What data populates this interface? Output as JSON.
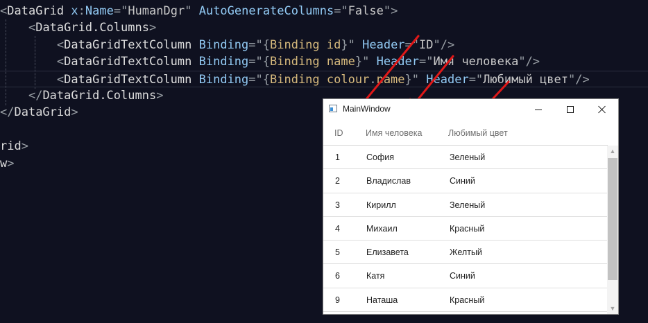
{
  "editor": {
    "lines": [
      {
        "indent": "",
        "segments": [
          {
            "t": "<",
            "c": "punct"
          },
          {
            "t": "DataGrid",
            "c": "tag"
          },
          {
            "t": " ",
            "c": "punct"
          },
          {
            "t": "x",
            "c": "ns"
          },
          {
            "t": ":",
            "c": "punct"
          },
          {
            "t": "Name",
            "c": "attr"
          },
          {
            "t": "=\"",
            "c": "punct"
          },
          {
            "t": "HumanDgr",
            "c": "str"
          },
          {
            "t": "\"",
            "c": "punct"
          },
          {
            "t": " ",
            "c": "punct"
          },
          {
            "t": "AutoGenerateColumns",
            "c": "attr"
          },
          {
            "t": "=\"",
            "c": "punct"
          },
          {
            "t": "False",
            "c": "str"
          },
          {
            "t": "\">",
            "c": "punct"
          }
        ]
      },
      {
        "indent": "    ",
        "segments": [
          {
            "t": "<",
            "c": "punct"
          },
          {
            "t": "DataGrid.Columns",
            "c": "tag"
          },
          {
            "t": ">",
            "c": "punct"
          }
        ]
      },
      {
        "indent": "        ",
        "segments": [
          {
            "t": "<",
            "c": "punct"
          },
          {
            "t": "DataGridTextColumn",
            "c": "tag"
          },
          {
            "t": " ",
            "c": "punct"
          },
          {
            "t": "Binding",
            "c": "attr"
          },
          {
            "t": "=\"{",
            "c": "punct"
          },
          {
            "t": "Binding",
            "c": "bind"
          },
          {
            "t": " ",
            "c": "punct"
          },
          {
            "t": "id",
            "c": "bind"
          },
          {
            "t": "}\"",
            "c": "punct"
          },
          {
            "t": " ",
            "c": "punct"
          },
          {
            "t": "Header",
            "c": "attr"
          },
          {
            "t": "=\"",
            "c": "punct"
          },
          {
            "t": "ID",
            "c": "str"
          },
          {
            "t": "\"/>",
            "c": "punct"
          }
        ]
      },
      {
        "indent": "        ",
        "segments": [
          {
            "t": "<",
            "c": "punct"
          },
          {
            "t": "DataGridTextColumn",
            "c": "tag"
          },
          {
            "t": " ",
            "c": "punct"
          },
          {
            "t": "Binding",
            "c": "attr"
          },
          {
            "t": "=\"{",
            "c": "punct"
          },
          {
            "t": "Binding",
            "c": "bind"
          },
          {
            "t": " ",
            "c": "punct"
          },
          {
            "t": "name",
            "c": "bind"
          },
          {
            "t": "}\"",
            "c": "punct"
          },
          {
            "t": " ",
            "c": "punct"
          },
          {
            "t": "Header",
            "c": "attr"
          },
          {
            "t": "=\"",
            "c": "punct"
          },
          {
            "t": "Имя человека",
            "c": "str"
          },
          {
            "t": "\"/>",
            "c": "punct"
          }
        ]
      },
      {
        "indent": "        ",
        "current": true,
        "segments": [
          {
            "t": "<",
            "c": "punct"
          },
          {
            "t": "DataGridTextColumn",
            "c": "tag"
          },
          {
            "t": " ",
            "c": "punct"
          },
          {
            "t": "Binding",
            "c": "attr"
          },
          {
            "t": "=\"{",
            "c": "punct"
          },
          {
            "t": "Binding",
            "c": "bind"
          },
          {
            "t": " ",
            "c": "punct"
          },
          {
            "t": "colour",
            "c": "bind"
          },
          {
            "t": ".",
            "c": "punct"
          },
          {
            "t": "name",
            "c": "bind"
          },
          {
            "t": "}\"",
            "c": "punct"
          },
          {
            "t": " ",
            "c": "punct"
          },
          {
            "t": "Header",
            "c": "attr"
          },
          {
            "t": "=\"",
            "c": "punct"
          },
          {
            "t": "Любимый цвет",
            "c": "str"
          },
          {
            "t": "\"/>",
            "c": "punct"
          }
        ]
      },
      {
        "indent": "    ",
        "segments": [
          {
            "t": "</",
            "c": "punct"
          },
          {
            "t": "DataGrid.Columns",
            "c": "tag"
          },
          {
            "t": ">",
            "c": "punct"
          }
        ]
      },
      {
        "indent": "",
        "segments": [
          {
            "t": "</",
            "c": "punct"
          },
          {
            "t": "DataGrid",
            "c": "tag"
          },
          {
            "t": ">",
            "c": "punct"
          }
        ]
      },
      {
        "indent": "",
        "segments": []
      },
      {
        "indent": "",
        "segments": [
          {
            "t": "rid",
            "c": "tag"
          },
          {
            "t": ">",
            "c": "punct"
          }
        ]
      },
      {
        "indent": "",
        "segments": [
          {
            "t": "w",
            "c": "tag"
          },
          {
            "t": ">",
            "c": "punct"
          }
        ]
      }
    ]
  },
  "colors": {
    "background": "#0f1120",
    "arrow": "#e01818",
    "window_bg": "#ffffff",
    "scroll_thumb": "#c2c2c2"
  },
  "window": {
    "title": "MainWindow",
    "icon": "app-window-icon",
    "buttons": {
      "minimize": "minimize-icon",
      "maximize": "maximize-icon",
      "close": "close-icon"
    }
  },
  "grid": {
    "columns": {
      "id": "ID",
      "name": "Имя человека",
      "colour": "Любимый цвет"
    },
    "rows": [
      {
        "id": "1",
        "name": "София",
        "colour": "Зеленый"
      },
      {
        "id": "2",
        "name": "Владислав",
        "colour": "Синий"
      },
      {
        "id": "3",
        "name": "Кирилл",
        "colour": "Зеленый"
      },
      {
        "id": "4",
        "name": "Михаил",
        "colour": "Красный"
      },
      {
        "id": "5",
        "name": "Елизавета",
        "colour": "Желтый"
      },
      {
        "id": "6",
        "name": "Катя",
        "colour": "Синий"
      },
      {
        "id": "9",
        "name": "Наташа",
        "colour": "Красный"
      }
    ],
    "scrollbar": {
      "up_glyph": "▲",
      "down_glyph": "▼",
      "visible_fraction": 0.85
    }
  }
}
